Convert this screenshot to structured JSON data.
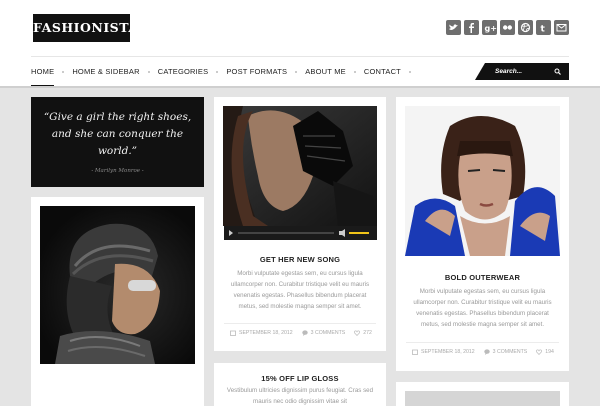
{
  "header": {
    "logo": "FASHIONISTA",
    "social": [
      "twitter-icon",
      "facebook-icon",
      "google-plus-icon",
      "flickr-icon",
      "dribbble-icon",
      "tumblr-icon",
      "email-icon"
    ]
  },
  "nav": {
    "items": [
      "HOME",
      "HOME & SIDEBAR",
      "CATEGORIES",
      "POST FORMATS",
      "ABOUT ME",
      "CONTACT"
    ],
    "search_placeholder": "Search..."
  },
  "quote": {
    "text": "“Give a girl the right shoes, and she can conquer the world.”",
    "author": "- Marilyn Monroe -"
  },
  "posts": [
    {
      "title": "GET HER NEW SONG",
      "excerpt": "Morbi vulputate egestas sem, eu cursus ligula ullamcorper non. Curabitur tristique velit eu mauris venenatis egestas. Phasellus bibendum placerat metus, sed molestie magna semper sit amet.",
      "date": "SEPTEMBER 18, 2012",
      "comments": "3 COMMENTS",
      "likes": "272"
    },
    {
      "title": "BOLD OUTERWEAR",
      "excerpt": "Morbi vulputate egestas sem, eu cursus ligula ullamcorper non. Curabitur tristique velit eu mauris venenatis egestas. Phasellus bibendum placerat metus, sed molestie magna semper sit amet.",
      "date": "SEPTEMBER 18, 2012",
      "comments": "3 COMMENTS",
      "likes": "194"
    },
    {
      "title": "15% OFF LIP GLOSS",
      "excerpt": "Vestibulum ultricies dignissim purus feugiat. Cras sed mauris nec odio dignissim vitae sit"
    }
  ],
  "colors": {
    "accent": "#111111",
    "background": "#e4e4e4",
    "text_muted": "#9a9a9a",
    "player_progress": "#f0c419"
  }
}
